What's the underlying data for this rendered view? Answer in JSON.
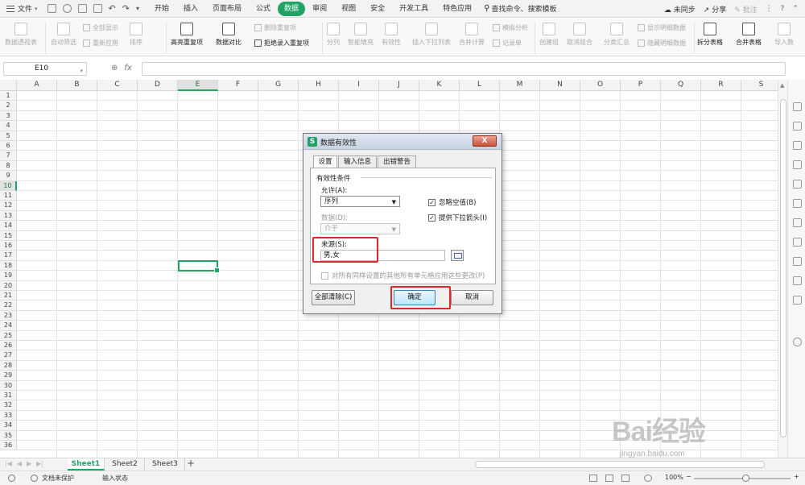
{
  "menubar": {
    "file_label": "文件",
    "tabs": [
      "开始",
      "插入",
      "页面布局",
      "公式",
      "数据",
      "审阅",
      "视图",
      "安全",
      "开发工具",
      "特色应用"
    ],
    "active_tab": "数据",
    "search_label": "查找命令、搜索模板",
    "sync_label": "未同步",
    "share_label": "分享",
    "comment_label": "批注"
  },
  "ribbon": {
    "pivot": "数据透视表",
    "autofilter": "自动筛选",
    "show_all": "全部显示",
    "reapply": "重新应用",
    "sort": "排序",
    "highlight_dup": "高亮重复项",
    "delete_dup": "删除重复项",
    "reject_dup": "拒绝录入重复项",
    "compare": "数据对比",
    "split": "分列",
    "smart_fill": "智能填充",
    "validity": "有效性",
    "insert_dropdown": "插入下拉列表",
    "consolidate": "合并计算",
    "simulate": "模拟分析",
    "record_form": "记录单",
    "group": "创建组",
    "ungroup": "取消组合",
    "subtotal": "分类汇总",
    "show_detail": "显示明细数据",
    "hide_detail": "隐藏明细数据",
    "split_table": "拆分表格",
    "merge_table": "合并表格",
    "import_data": "导入数"
  },
  "formula_bar": {
    "cell_ref": "E10",
    "fx_label": "fx",
    "formula": ""
  },
  "grid": {
    "columns": [
      "A",
      "B",
      "C",
      "D",
      "E",
      "F",
      "G",
      "H",
      "I",
      "J",
      "K",
      "L",
      "M",
      "N",
      "O",
      "P",
      "Q",
      "R",
      "S"
    ],
    "rows": [
      "1",
      "2",
      "3",
      "4",
      "5",
      "6",
      "7",
      "8",
      "9",
      "10",
      "11",
      "12",
      "13",
      "14",
      "15",
      "16",
      "17",
      "18",
      "19",
      "20",
      "21",
      "22",
      "23",
      "24",
      "25",
      "26",
      "27",
      "28",
      "29",
      "30",
      "31",
      "32",
      "33",
      "34",
      "35",
      "36"
    ],
    "selected_column": "E",
    "selected_row": "10"
  },
  "dialog": {
    "title": "数据有效性",
    "close_label": "X",
    "tabs": [
      "设置",
      "输入信息",
      "出错警告"
    ],
    "active_tab": "设置",
    "group_label": "有效性条件",
    "allow_label": "允许(A):",
    "allow_value": "序列",
    "data_label": "数据(D):",
    "data_value": "介于",
    "ignore_blank_label": "忽略空值(B)",
    "ignore_blank_checked": true,
    "dropdown_label": "提供下拉箭头(I)",
    "dropdown_checked": true,
    "source_label": "来源(S):",
    "source_value": "男,女",
    "apply_all_label": "对所有同样设置的其他所有单元格应用这些更改(P)",
    "apply_all_checked": false,
    "clear_all_label": "全部清除(C)",
    "ok_label": "确定",
    "cancel_label": "取消",
    "highlight_color": "#e0262c"
  },
  "sheet_tabs": [
    "Sheet1",
    "Sheet2",
    "Sheet3"
  ],
  "active_sheet": "Sheet1",
  "add_sheet_label": "+",
  "status": {
    "protect_label": "文档未保护",
    "mode_label": "输入状态",
    "zoom_label": "100%"
  },
  "watermark": {
    "logo": "Bai经验",
    "url": "jingyan.baidu.com"
  },
  "colors": {
    "accent": "#21a366",
    "highlight": "#e0262c"
  }
}
